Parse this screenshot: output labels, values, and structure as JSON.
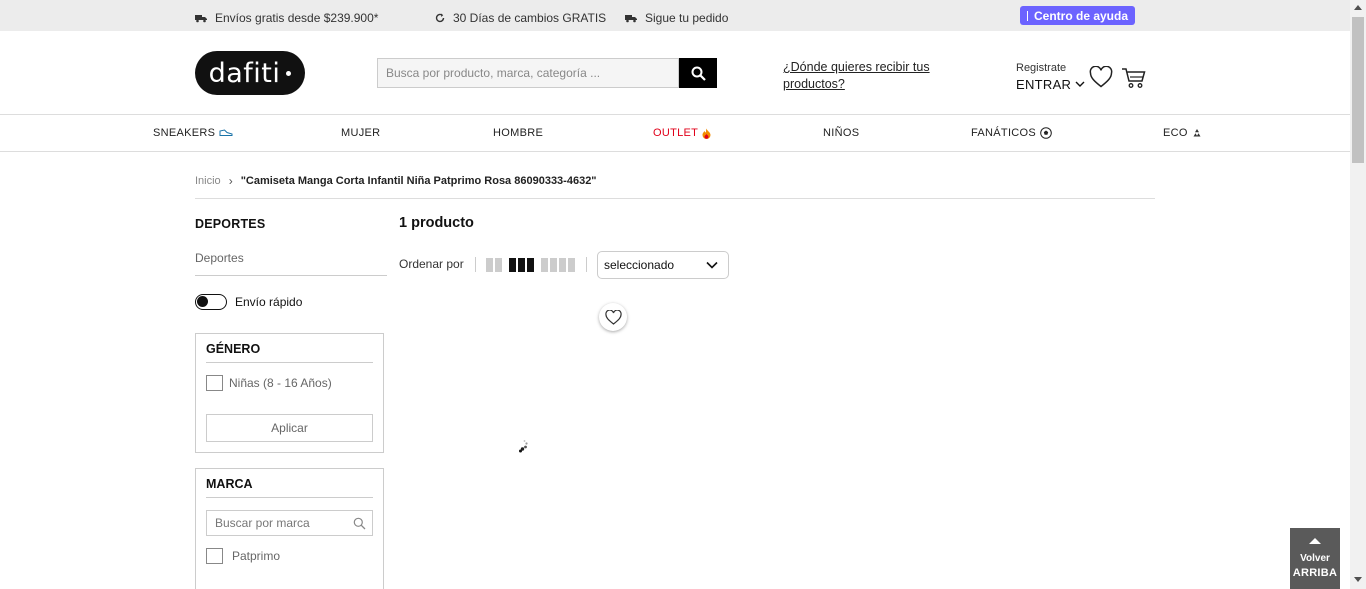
{
  "topbar": {
    "promo_shipping": "Envíos gratis desde $239.900*",
    "promo_returns": "30 Días de cambios GRATIS",
    "promo_tracking": "Sigue tu pedido",
    "help_label": "Centro de ayuda",
    "help_color": "#6c63ff"
  },
  "header": {
    "logo_text": "dafiti",
    "search_placeholder": "Busca por producto, marca, categoría ...",
    "delivery_link": "¿Dónde quieres recibir tus productos?",
    "register_label": "Registrate",
    "enter_label": "ENTRAR"
  },
  "nav": {
    "items": [
      {
        "label": "SNEAKERS",
        "icon": "sneaker-icon"
      },
      {
        "label": "MUJER"
      },
      {
        "label": "HOMBRE"
      },
      {
        "label": "OUTLET",
        "icon": "fire-icon",
        "color": "#e1001a"
      },
      {
        "label": "NIÑOS"
      },
      {
        "label": "FANÁTICOS",
        "icon": "soccer-ball-icon"
      },
      {
        "label": "ECO",
        "icon": "recycle-icon"
      }
    ]
  },
  "breadcrumb": {
    "home": "Inicio",
    "separator": "›",
    "current": "\"Camiseta Manga Corta Infantil Niña Patprimo Rosa 86090333-4632\""
  },
  "sidebar": {
    "category_title": "DEPORTES",
    "category_link": "Deportes",
    "fast_shipping_label": "Envío rápido",
    "gender": {
      "title": "GÉNERO",
      "options": [
        "Niñas (8 - 16 Años)"
      ],
      "apply_label": "Aplicar"
    },
    "brand": {
      "title": "MARCA",
      "search_placeholder": "Buscar por marca",
      "options": [
        "Patprimo"
      ]
    }
  },
  "main": {
    "product_count": "1 producto",
    "sort_label": "Ordenar por",
    "sort_selected": "seleccionado"
  },
  "back_to_top": {
    "line1": "Volver",
    "line2": "ARRIBA"
  }
}
